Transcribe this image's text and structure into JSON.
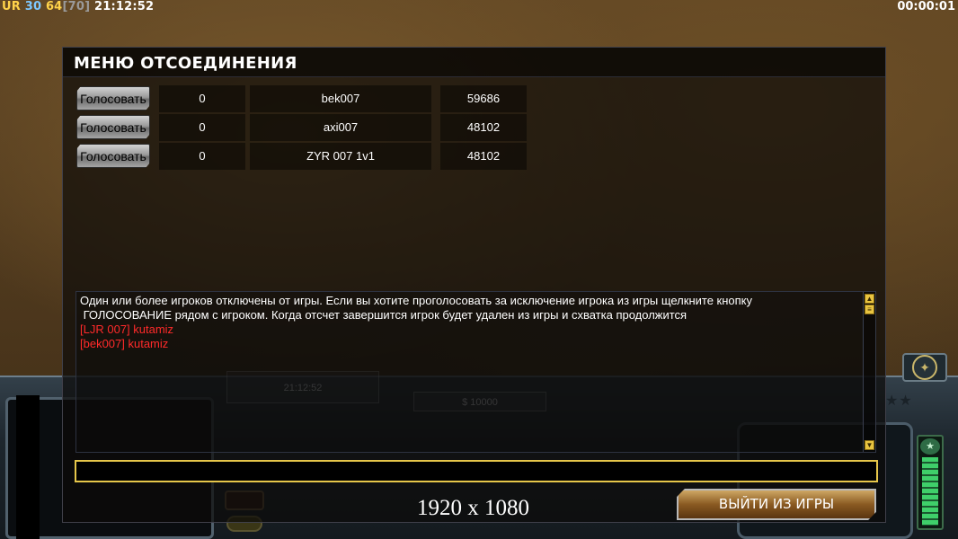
{
  "hud": {
    "tag": "UR",
    "fps": "30",
    "val64": "64",
    "val70": "[70]",
    "clock": "21:12:52",
    "timer": "00:00:01"
  },
  "background_hud": {
    "time_ghost": "21:12:52",
    "money_ghost": "$ 10000"
  },
  "dialog": {
    "title": "МЕНЮ ОТСОЕДИНЕНИЯ",
    "rows": [
      {
        "vote_label": "Голосовать",
        "count": "0",
        "player": "bek007",
        "ping": "59686"
      },
      {
        "vote_label": "Голосовать",
        "count": "0",
        "player": "axi007",
        "ping": "48102"
      },
      {
        "vote_label": "Голосовать",
        "count": "0",
        "player": "ZYR 007 1v1",
        "ping": "48102"
      }
    ],
    "chat": {
      "system_line1": "Один или более игроков отключены от игры. Если вы хотите проголосовать за исключение игрока из игры щелкните кнопку",
      "system_line2": " ГОЛОСОВАНИЕ рядом с игроком. Когда отсчет завершится игрок будет удален из игры и схватка продолжится",
      "messages": [
        "[LJR 007] kutamiz",
        "[bek007] kutamiz"
      ],
      "message_color": "#ff2a2a"
    },
    "input_value": "",
    "resolution": "1920 x 1080",
    "exit_label": "ВЫЙТИ ИЗ ИГРЫ"
  },
  "icons": {
    "scroll_up": "scroll-up-icon",
    "scroll_down": "scroll-down-icon",
    "emblem": "radar-emblem-icon",
    "power": "power-meter-icon"
  }
}
